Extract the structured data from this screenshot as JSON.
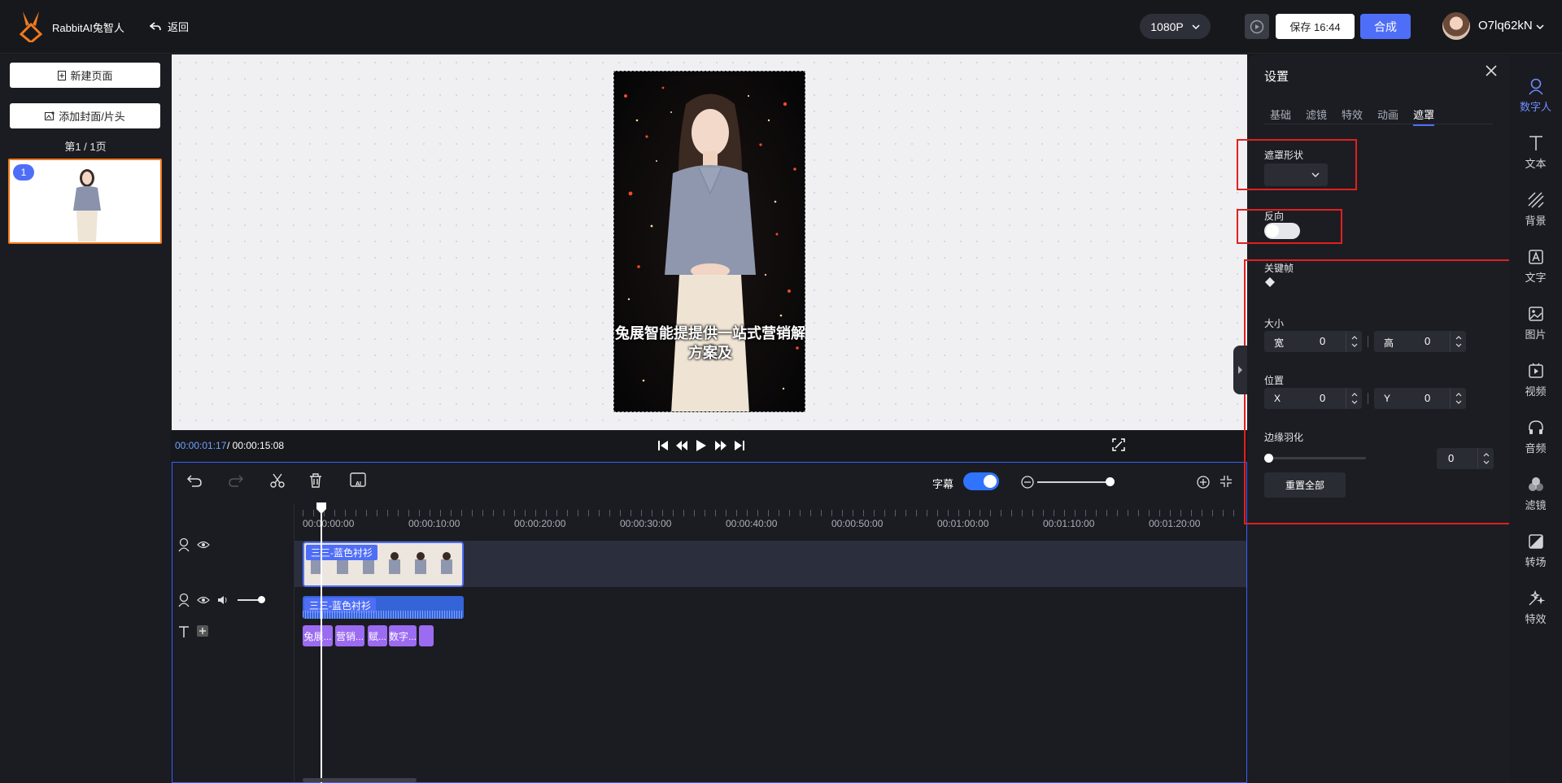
{
  "header": {
    "brand": "RabbitAI兔智人",
    "back_label": "返回",
    "resolution": "1080P",
    "save_label": "保存 16:44",
    "compose_label": "合成",
    "username": "O7lq62kN"
  },
  "pages": {
    "new_page_label": "新建页面",
    "add_cover_label": "添加封面/片头",
    "page_count": "第1 / 1页",
    "thumb_index": "1"
  },
  "canvas": {
    "caption_line1": "兔展智能提提供一站式营销解决",
    "caption_line2": "方案及"
  },
  "playback": {
    "current_time": "00:00:01:17",
    "total_time": "/ 00:00:15:08"
  },
  "timeline": {
    "subtitle_label": "字幕",
    "ticks": [
      "00:00:00:00",
      "00:00:10:00",
      "00:00:20:00",
      "00:00:30:00",
      "00:00:40:00",
      "00:00:50:00",
      "00:01:00:00",
      "00:01:10:00",
      "00:01:20:00"
    ],
    "video_clip_label": "三三-蓝色衬衫",
    "audio_clip_label": "三三-蓝色衬衫",
    "subtitle_chips": [
      "兔展...",
      "营销...",
      "赋...",
      "数字...",
      ""
    ]
  },
  "settings": {
    "title": "设置",
    "tabs": [
      "基础",
      "滤镜",
      "特效",
      "动画",
      "遮罩"
    ],
    "active_tab": "遮罩",
    "mask_shape_label": "遮罩形状",
    "reverse_label": "反向",
    "keyframe_label": "关键帧",
    "size_label": "大小",
    "width_label": "宽",
    "width_value": "0",
    "height_label": "高",
    "height_value": "0",
    "position_label": "位置",
    "x_label": "X",
    "x_value": "0",
    "y_label": "Y",
    "y_value": "0",
    "feather_label": "边缘羽化",
    "feather_value": "0",
    "reset_label": "重置全部"
  },
  "rail": [
    {
      "label": "数字人",
      "icon": "digital-human-icon"
    },
    {
      "label": "文本",
      "icon": "text-icon"
    },
    {
      "label": "背景",
      "icon": "background-icon"
    },
    {
      "label": "文字",
      "icon": "font-icon"
    },
    {
      "label": "图片",
      "icon": "image-icon"
    },
    {
      "label": "视频",
      "icon": "video-icon"
    },
    {
      "label": "音频",
      "icon": "audio-icon"
    },
    {
      "label": "滤镜",
      "icon": "filter-icon"
    },
    {
      "label": "转场",
      "icon": "transition-icon"
    },
    {
      "label": "特效",
      "icon": "effects-icon"
    }
  ],
  "colors": {
    "accent": "#4f6ef7",
    "highlight_box": "#e02020",
    "selected_thumb": "#f07a1f"
  }
}
